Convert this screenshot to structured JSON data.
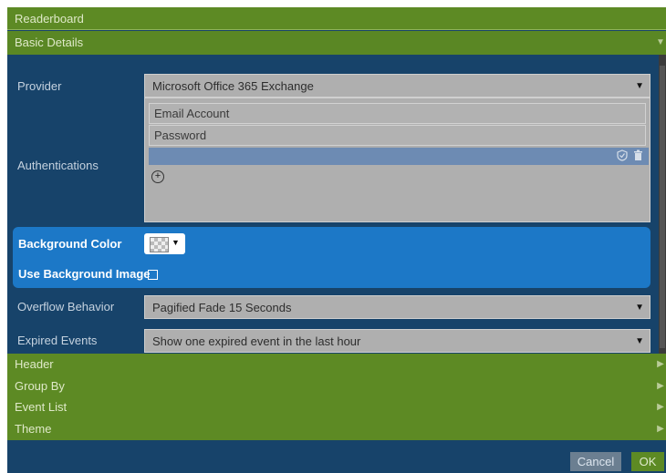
{
  "dialog": {
    "title": "Readerboard",
    "section_basic": "Basic Details",
    "provider": {
      "label": "Provider",
      "value": "Microsoft Office 365 Exchange"
    },
    "authentications": {
      "label": "Authentications",
      "email_placeholder": "Email Account",
      "password_placeholder": "Password"
    },
    "background_color": {
      "label": "Background Color"
    },
    "use_background_image": {
      "label": "Use Background Image",
      "checked": false
    },
    "overflow": {
      "label": "Overflow Behavior",
      "value": "Pagified Fade 15 Seconds"
    },
    "expired": {
      "label": "Expired Events",
      "value": "Show one expired event in the last hour"
    },
    "sections": [
      {
        "label": "Header"
      },
      {
        "label": "Group By"
      },
      {
        "label": "Event List"
      },
      {
        "label": "Theme"
      }
    ],
    "buttons": {
      "cancel": "Cancel",
      "ok": "OK"
    }
  },
  "icons": {
    "expand_down": "chevron-down-icon",
    "collapse_right": "chevron-right-icon",
    "shield": "shield-icon",
    "trash": "trash-icon",
    "add": "add-circle-icon"
  },
  "colors": {
    "green_bar": "#5d8a24",
    "panel_bg": "#17436a",
    "highlight_bg": "#1c78c7",
    "field_bg": "#afafaf"
  }
}
